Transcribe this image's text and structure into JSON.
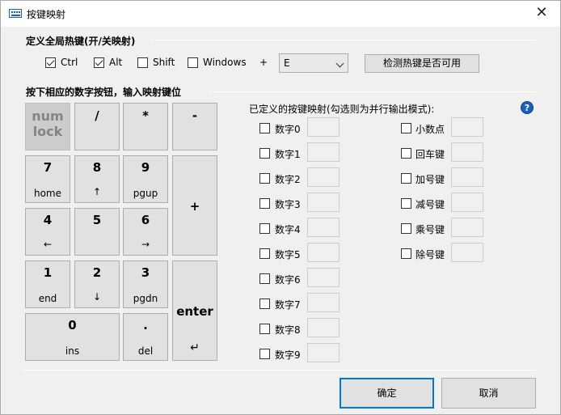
{
  "window": {
    "title": "按键映射",
    "close_symbol": "✕"
  },
  "hotkey": {
    "section_title": "定义全局热键(开/关映射)",
    "modifiers": [
      {
        "label": "Ctrl",
        "checked": true
      },
      {
        "label": "Alt",
        "checked": true
      },
      {
        "label": "Shift",
        "checked": false
      },
      {
        "label": "Windows",
        "checked": false
      }
    ],
    "plus": "+",
    "key_select": "E",
    "test_button": "检测热键是否可用"
  },
  "keypad": {
    "section_title": "按下相应的数字按钮，输入映射键位",
    "keys": {
      "numlock": [
        "num",
        "lock"
      ],
      "divide": "/",
      "multiply": "*",
      "minus": "-",
      "k7": [
        "7",
        "home"
      ],
      "k8": [
        "8",
        "↑"
      ],
      "k9": [
        "9",
        "pgup"
      ],
      "plus": "+",
      "k4": [
        "4",
        "←"
      ],
      "k5": [
        "5"
      ],
      "k6": [
        "6",
        "→"
      ],
      "k1": [
        "1",
        "end"
      ],
      "k2": [
        "2",
        "↓"
      ],
      "k3": [
        "3",
        "pgdn"
      ],
      "enter": [
        "enter",
        "↵"
      ],
      "k0": [
        "0",
        "ins"
      ],
      "dot": [
        ".",
        "del"
      ]
    }
  },
  "mapping": {
    "title": "已定义的按键映射(勾选则为并行输出模式):",
    "help_symbol": "?",
    "left_items": [
      "数字0",
      "数字1",
      "数字2",
      "数字3",
      "数字4",
      "数字5",
      "数字6",
      "数字7",
      "数字8",
      "数字9"
    ],
    "right_items": [
      "小数点",
      "回车键",
      "加号键",
      "减号键",
      "乘号键",
      "除号键"
    ]
  },
  "footer": {
    "ok": "确定",
    "cancel": "取消"
  }
}
